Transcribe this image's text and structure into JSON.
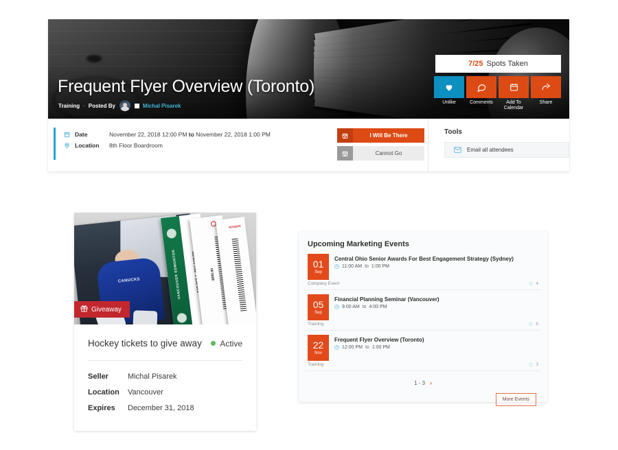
{
  "event": {
    "title": "Frequent Flyer Overview (Toronto)",
    "category": "Training",
    "posted_by_label": "Posted By",
    "separator": "·",
    "author": "Michal Pisarek",
    "spots": {
      "taken": "7/25",
      "label": "Spots Taken"
    },
    "actions": [
      {
        "name": "unlike",
        "label": "Unlike",
        "icon": "heart-filled-icon",
        "color": "#0d8fc0"
      },
      {
        "name": "comments",
        "label": "Comments",
        "icon": "comment-icon",
        "color": "#dd4b15"
      },
      {
        "name": "add-to-calendar",
        "label": "Add To Calendar",
        "icon": "calendar-icon",
        "color": "#dd4b15"
      },
      {
        "name": "share",
        "label": "Share",
        "icon": "share-arrow-icon",
        "color": "#dd4b15"
      }
    ],
    "details": {
      "date_label": "Date",
      "date_start": "November 22, 2018 12:00 PM",
      "date_joiner": "to",
      "date_end": "November 22, 2018 1:00 PM",
      "location_label": "Location",
      "location_value": "8th Floor Boardroom"
    },
    "rsvp": {
      "attend_label": "I Will Be There",
      "decline_label": "Cannot Go"
    },
    "tools": {
      "heading": "Tools",
      "email_all_label": "Email all attendees"
    }
  },
  "giveaway": {
    "badge_label": "Giveaway",
    "title": "Hockey tickets to give away",
    "status": "Active",
    "status_color": "#5cb85c",
    "fields": [
      {
        "key": "Seller",
        "value": "Michal Pisarek"
      },
      {
        "key": "Location",
        "value": "Vancouver"
      },
      {
        "key": "Expires",
        "value": "December 31, 2018"
      }
    ],
    "ticket": {
      "teams": "VANCOUVER EDMONTON",
      "datetime": "SAT OCT. 1, 2011 7:00 PM",
      "price": "$000.00",
      "brand": "ROGERS"
    }
  },
  "upcoming": {
    "title": "Upcoming Marketing Events",
    "events": [
      {
        "day": "01",
        "month": "Sep",
        "name": "Central Ohio Senior Awards For Best Engagement Strategy (Sydney)",
        "time_start": "11:00 AM",
        "time_joiner": "to",
        "time_end": "1:00 PM",
        "category": "Company Event",
        "likes": "4"
      },
      {
        "day": "05",
        "month": "Sep",
        "name": "Financial Planning Seminar (Vancouver)",
        "time_start": "9:00 AM",
        "time_joiner": "to",
        "time_end": "4:00 PM",
        "category": "Training",
        "likes": "6"
      },
      {
        "day": "22",
        "month": "Nov",
        "name": "Frequent Flyer Overview (Toronto)",
        "time_start": "12:00 PM",
        "time_joiner": "to",
        "time_end": "1:00 PM",
        "category": "Training",
        "likes": "3"
      }
    ],
    "pager": "1 - 3",
    "pager_next_icon": "chevron-right-icon",
    "more_label": "More Events"
  },
  "theme": {
    "orange": "#dd4b15",
    "cyan": "#22a3d2",
    "red": "#c1272d",
    "green": "#5cb85c"
  }
}
